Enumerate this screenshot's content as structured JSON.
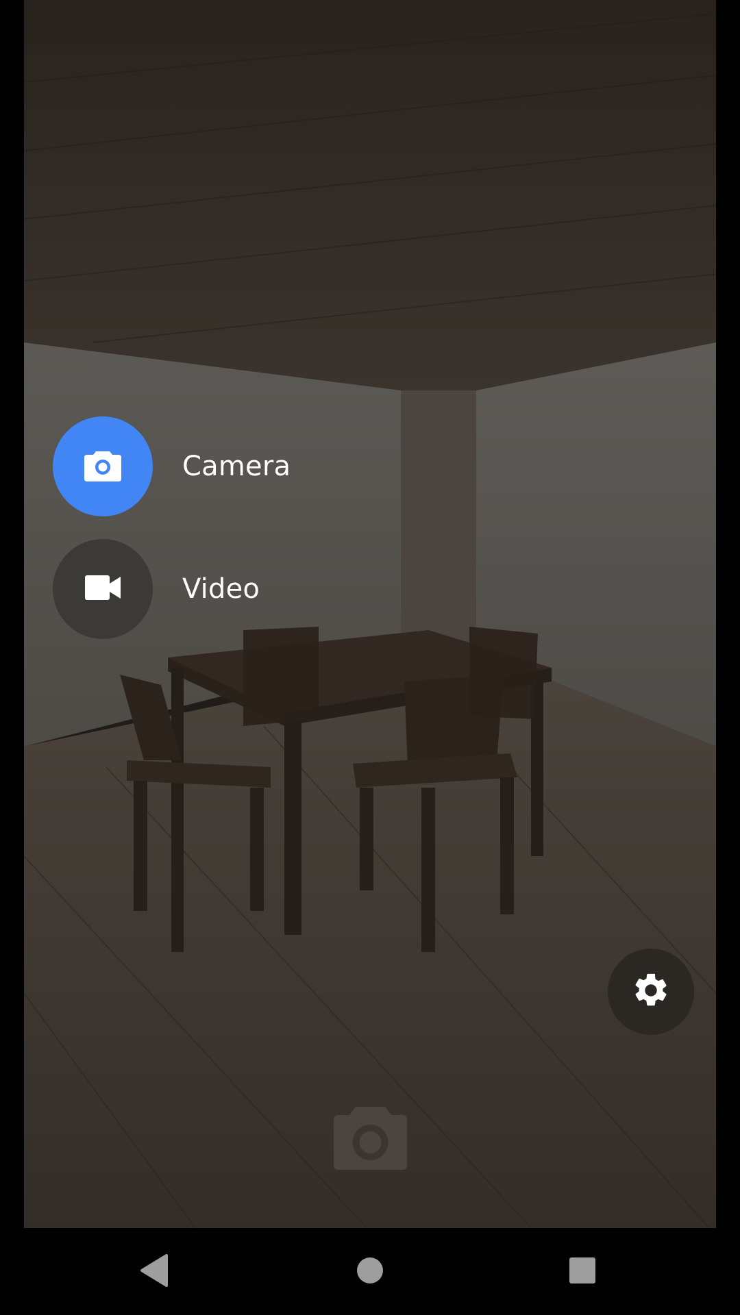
{
  "modes": [
    {
      "label": "Camera",
      "icon": "camera-icon",
      "selected": true,
      "color": "#4285F4"
    },
    {
      "label": "Video",
      "icon": "videocam-icon",
      "selected": false,
      "color": "#3c3a37"
    }
  ],
  "settings": {
    "icon": "gear-icon"
  },
  "shutter": {
    "icon": "camera-shutter-icon"
  },
  "nav": {
    "back_icon": "back-triangle-icon",
    "home_icon": "home-circle-icon",
    "recents_icon": "recents-square-icon"
  }
}
